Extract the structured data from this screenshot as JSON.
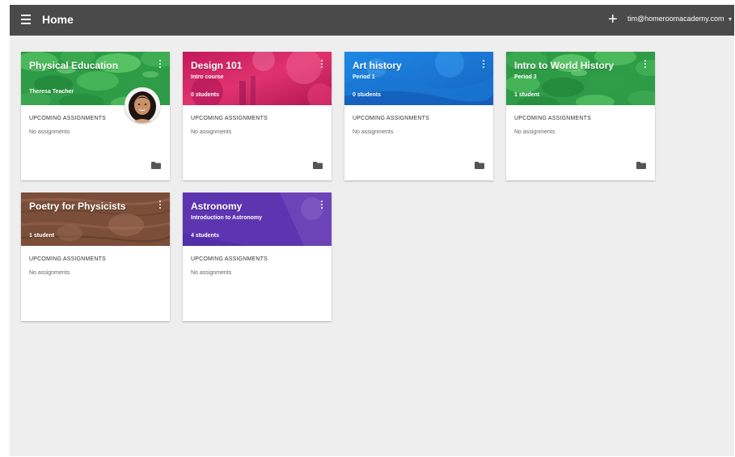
{
  "header": {
    "title": "Home",
    "add_label": "+",
    "account_email": "tim@homeroomacademy.com",
    "account_caret": "▼"
  },
  "colors": {
    "topbar": "#4a4a4a",
    "background": "#eeeeee"
  },
  "labels": {
    "upcoming": "UPCOMING ASSIGNMENTS",
    "no_assignments": "No assignments"
  },
  "classes": [
    {
      "name": "Physical Education",
      "teacher": "Theresa Teacher",
      "subtitle": "",
      "count": "",
      "theme": "green"
    },
    {
      "name": "Design 101",
      "subtitle": "Intro course",
      "count": "0 students",
      "theme": "pink"
    },
    {
      "name": "Art history",
      "subtitle": "Period 1",
      "count": "0 students",
      "theme": "blue"
    },
    {
      "name": "Intro to World History",
      "subtitle": "Period 3",
      "count": "1 student",
      "theme": "green"
    },
    {
      "name": "Poetry for Physicists",
      "subtitle": "",
      "count": "1 student",
      "theme": "brown"
    },
    {
      "name": "Astronomy",
      "subtitle": "Introduction to Astronomy",
      "count": "4 students",
      "theme": "purple"
    }
  ]
}
